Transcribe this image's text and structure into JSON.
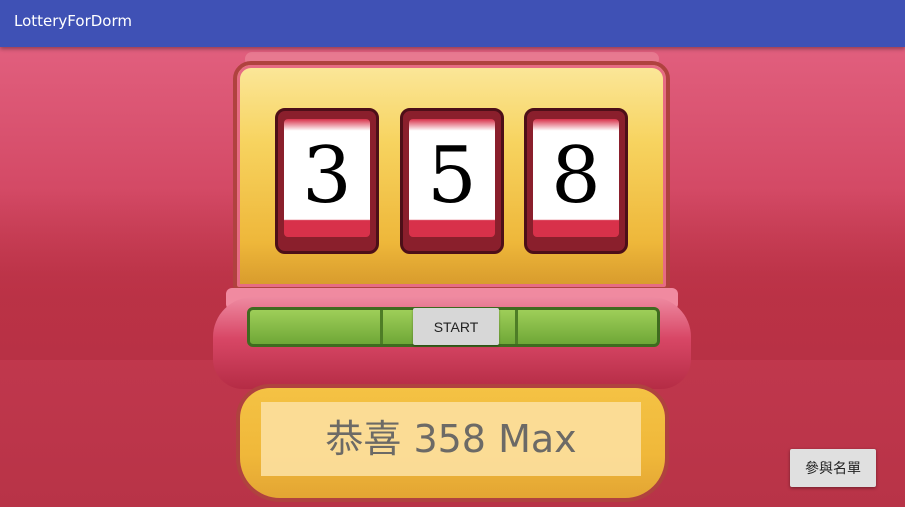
{
  "app": {
    "title": "LotteryForDorm"
  },
  "reels": [
    {
      "value": "3"
    },
    {
      "value": "5"
    },
    {
      "value": "8"
    }
  ],
  "controls": {
    "start_label": "START",
    "participants_label": "參與名單"
  },
  "result": {
    "text": "恭喜 358 Max"
  },
  "colors": {
    "appbar": "#3f51b5",
    "background": "#c44257",
    "machine_gold": "#f4c244",
    "console_green": "#8cc34a"
  }
}
